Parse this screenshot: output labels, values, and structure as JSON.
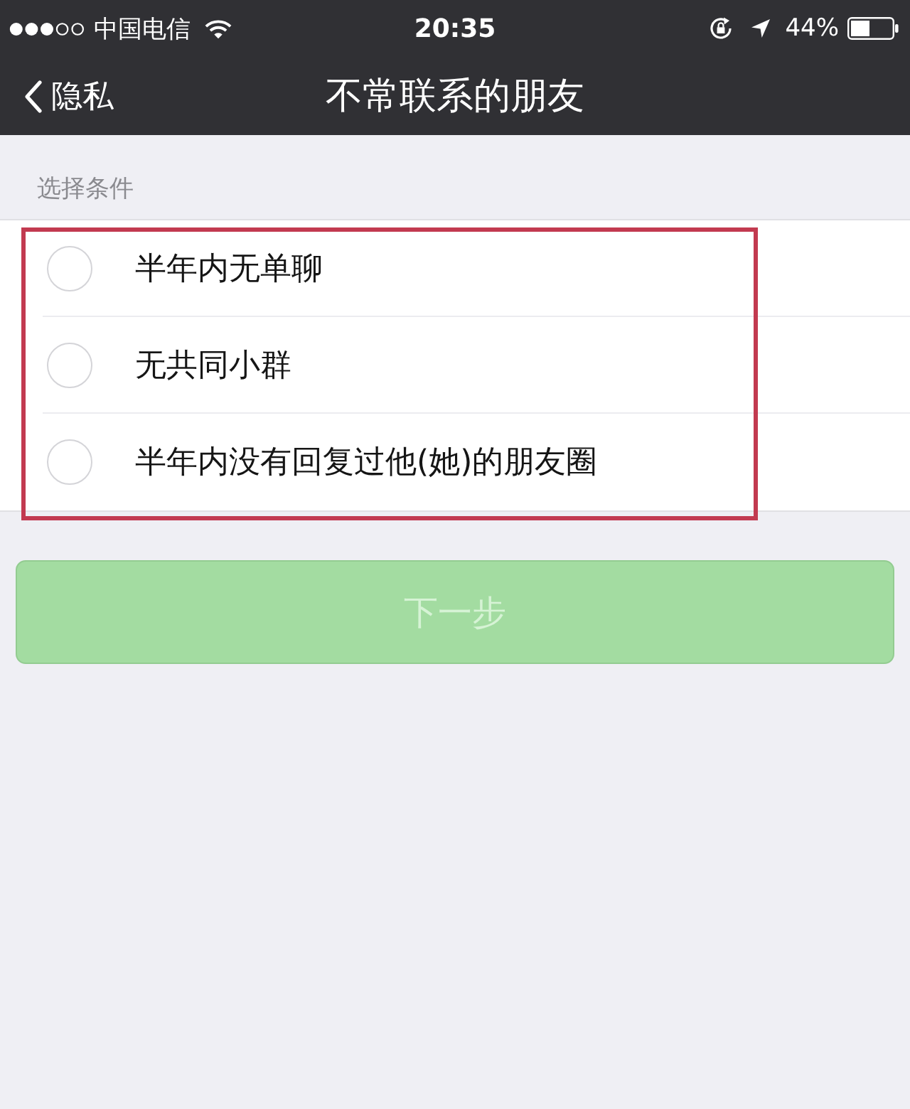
{
  "status_bar": {
    "carrier": "中国电信",
    "time": "20:35",
    "battery": "44%"
  },
  "nav_bar": {
    "back_label": "隐私",
    "title": "不常联系的朋友"
  },
  "section": {
    "header": "选择条件",
    "highlighted": true,
    "options": [
      {
        "label": "半年内无单聊",
        "selected": false
      },
      {
        "label": "无共同小群",
        "selected": false
      },
      {
        "label": "半年内没有回复过他(她)的朋友圈",
        "selected": false
      }
    ]
  },
  "next_button": {
    "label": "下一步",
    "disabled": true
  }
}
